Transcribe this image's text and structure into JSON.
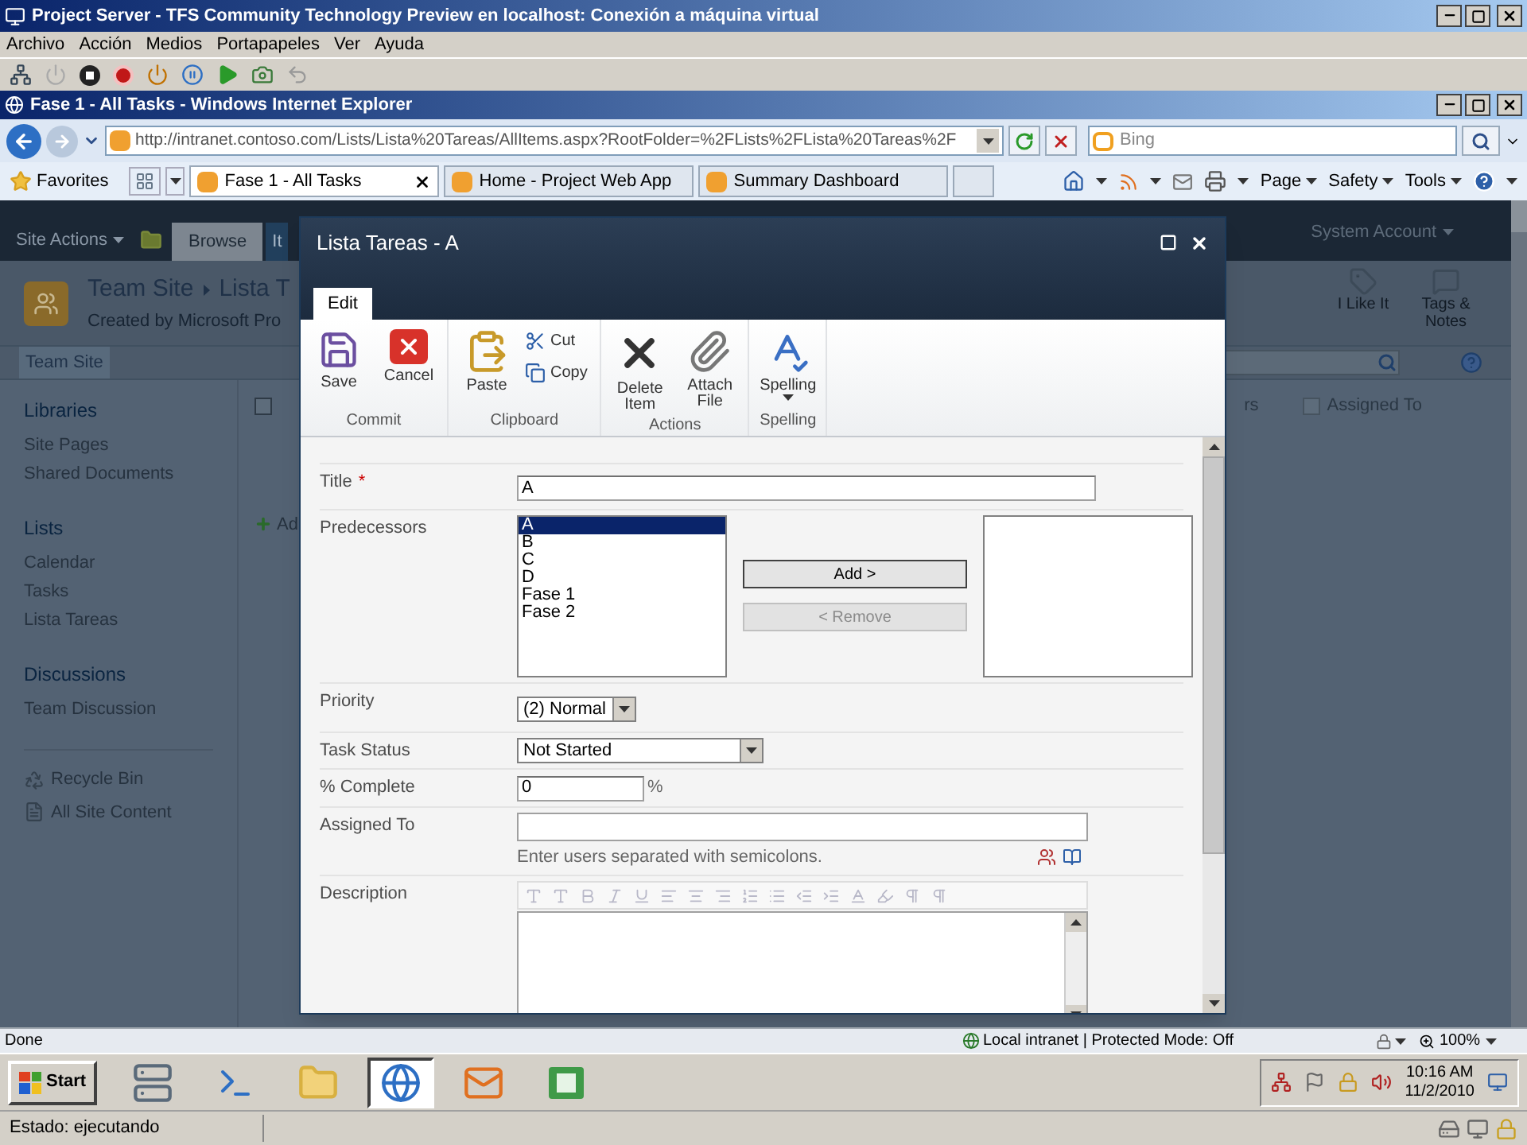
{
  "vm_window": {
    "title": "Project Server - TFS Community Technology Preview en localhost: Conexión a máquina virtual",
    "menu": [
      "Archivo",
      "Acción",
      "Medios",
      "Portapapeles",
      "Ver",
      "Ayuda"
    ]
  },
  "browser": {
    "title": "Fase 1 - All Tasks - Windows Internet Explorer",
    "address": "http://intranet.contoso.com/Lists/Lista%20Tareas/AllItems.aspx?RootFolder=%2FLists%2FLista%20Tareas%2F",
    "search": {
      "placeholder": "Bing"
    },
    "favorites": "Favorites",
    "tabs": [
      {
        "label": "Fase 1 - All Tasks",
        "selected": true
      },
      {
        "label": "Home - Project Web App",
        "selected": false
      },
      {
        "label": "Summary Dashboard",
        "selected": false
      }
    ],
    "commands": [
      "Page",
      "Safety",
      "Tools"
    ],
    "status": "Done",
    "zone": "Local intranet | Protected Mode: Off",
    "zoom": "100%"
  },
  "sharepoint": {
    "site_actions": "Site Actions",
    "ribbon_tabs": [
      {
        "label": "Browse",
        "selected": true
      },
      {
        "label": "It",
        "selected": false
      }
    ],
    "account": "System Account",
    "site_title": "Team Site",
    "breadcrumb": "Lista T",
    "subtitle": "Created by Microsoft Pro",
    "social": [
      "I Like It",
      "Tags & Notes"
    ],
    "top_nav": "Team Site",
    "quick_launch": [
      {
        "heading": "Libraries",
        "items": [
          "Site Pages",
          "Shared Documents"
        ]
      },
      {
        "heading": "Lists",
        "items": [
          "Calendar",
          "Tasks",
          "Lista Tareas"
        ]
      },
      {
        "heading": "Discussions",
        "items": [
          "Team Discussion"
        ]
      }
    ],
    "footer_links": [
      {
        "label": "Recycle Bin",
        "kind": "recycle"
      },
      {
        "label": "All Site Content",
        "kind": "content"
      }
    ],
    "select_all": {
      "checked": false
    },
    "columns": [
      {
        "label": "rs",
        "kind": "text"
      },
      {
        "label": "Assigned To",
        "kind": "checkbox",
        "checked": false
      }
    ],
    "add_link": "Ad"
  },
  "dialog": {
    "title": "Lista Tareas - A",
    "tabs": [
      {
        "label": "Edit",
        "selected": true
      }
    ],
    "ribbon": [
      {
        "label": "Commit",
        "buttons": [
          {
            "label": "Save",
            "kind": "save"
          },
          {
            "label": "Cancel",
            "kind": "cancel"
          }
        ]
      },
      {
        "label": "Clipboard",
        "buttons": [
          {
            "label": "Paste",
            "kind": "paste"
          },
          {
            "label": "Cut",
            "kind": "cut"
          },
          {
            "label": "Copy",
            "kind": "copy"
          }
        ]
      },
      {
        "label": "Actions",
        "buttons": [
          {
            "label": "Delete Item",
            "kind": "delete"
          },
          {
            "label": "Attach File",
            "kind": "attach"
          }
        ]
      },
      {
        "label": "Spelling",
        "buttons": [
          {
            "label": "Spelling",
            "kind": "spelling"
          }
        ]
      }
    ],
    "fields": [
      {
        "label": "Title",
        "required_mark": "*",
        "kind": "text",
        "value": "A"
      },
      {
        "label": "Predecessors",
        "kind": "picker",
        "options": [
          {
            "label": "A",
            "selected": true
          },
          {
            "label": "B",
            "selected": false
          },
          {
            "label": "C",
            "selected": false
          },
          {
            "label": "D",
            "selected": false
          },
          {
            "label": "Fase 1",
            "selected": false
          },
          {
            "label": "Fase 2",
            "selected": false
          }
        ],
        "add": {
          "label": "Add >",
          "disabled": false
        },
        "remove": {
          "label": "< Remove",
          "disabled": true
        }
      },
      {
        "label": "Priority",
        "kind": "dropdown",
        "value": "(2) Normal"
      },
      {
        "label": "Task Status",
        "kind": "select",
        "value": "Not Started"
      },
      {
        "label": "% Complete",
        "kind": "percent",
        "value": "0",
        "unit": "%"
      },
      {
        "label": "Assigned To",
        "kind": "people",
        "hint": "Enter users separated with semicolons."
      },
      {
        "label": "Description",
        "kind": "richtext"
      }
    ]
  },
  "taskbar": {
    "start": "Start",
    "apps": [
      {
        "kind": "server",
        "selected": false
      },
      {
        "kind": "shell",
        "selected": false
      },
      {
        "kind": "folder",
        "selected": false
      },
      {
        "kind": "browser",
        "selected": true
      },
      {
        "kind": "mail",
        "selected": false
      },
      {
        "kind": "project",
        "selected": false
      }
    ],
    "time": "10:16 AM",
    "date": "11/2/2010"
  },
  "vm_status": "Estado: ejecutando"
}
